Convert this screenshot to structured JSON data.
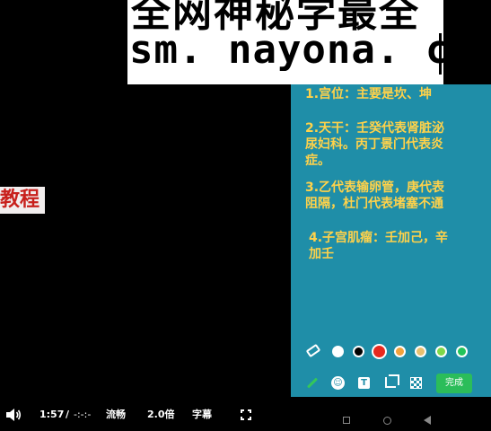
{
  "watermark": {
    "line1": "全网神秘学最全",
    "line2": "sm. nayona. cn"
  },
  "side_label": "教程",
  "notes": [
    {
      "text": "1.宫位：主要是坎、坤"
    },
    {
      "text": "2.天干：壬癸代表肾脏泌"
    },
    {
      "text": "尿妇科。丙丁景门代表炎"
    },
    {
      "text": "症。"
    },
    {
      "text": "3.乙代表输卵管，庚代表"
    },
    {
      "text": "阻隔，杜门代表堵塞不通"
    },
    {
      "text": "4.子宫肌瘤：壬加己，辛"
    },
    {
      "text": "加壬"
    }
  ],
  "colors": {
    "panel": "#1f8ea8",
    "note_text": "#ffd24a",
    "done_button": "#2bbd5a",
    "swatches": [
      "#ffffff",
      "#000000",
      "#e8281e",
      "#f0a23c",
      "#e8c070",
      "#7ed84a",
      "#22c35a"
    ]
  },
  "toolbar": {
    "done_label": "完成",
    "emoji_glyph": "☺",
    "text_glyph": "T"
  },
  "player": {
    "time_current": "1:57",
    "time_separator": "/",
    "time_total": "-:-:-",
    "quality_label": "流畅",
    "speed_label": "2.0倍",
    "subtitle_label": "字幕"
  }
}
